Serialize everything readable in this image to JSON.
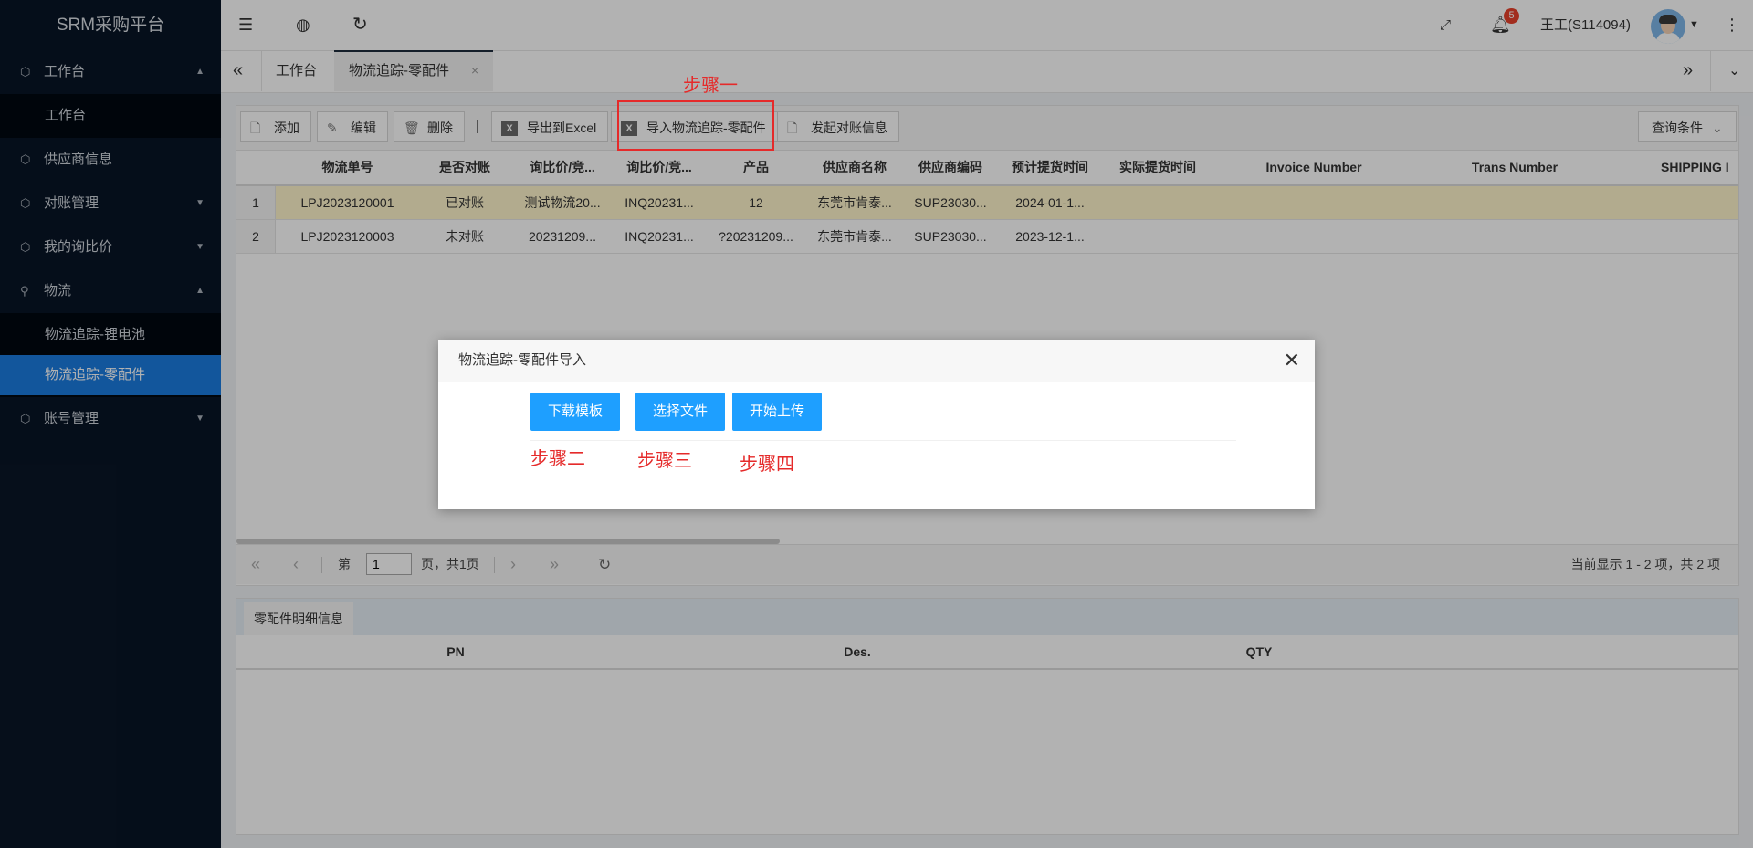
{
  "app": {
    "title": "SRM采购平台"
  },
  "sidebar": {
    "items": [
      {
        "label": "工作台",
        "expanded": true,
        "children": [
          "工作台"
        ]
      },
      {
        "label": "供应商信息"
      },
      {
        "label": "对账管理"
      },
      {
        "label": "我的询比价"
      },
      {
        "label": "物流",
        "expanded": true,
        "children": [
          "物流追踪-锂电池",
          "物流追踪-零配件"
        ],
        "active_child": "物流追踪-零配件"
      },
      {
        "label": "账号管理"
      }
    ]
  },
  "header": {
    "notification_count": "5",
    "user": "王工(S114094)"
  },
  "tabs": [
    {
      "label": "工作台"
    },
    {
      "label": "物流追踪-零配件",
      "active": true,
      "close": "×"
    }
  ],
  "toolbar": {
    "add": "添加",
    "edit": "编辑",
    "delete": "删除",
    "separator": "|",
    "export": "导出到Excel",
    "import": "导入物流追踪-零配件",
    "reconcile": "发起对账信息",
    "query": "查询条件"
  },
  "grid": {
    "columns": [
      "物流单号",
      "是否对账",
      "询比价/竞...",
      "询比价/竞...",
      "产品",
      "供应商名称",
      "供应商编码",
      "预计提货时间",
      "实际提货时间",
      "Invoice Number",
      "Trans Number",
      "SHIPPING I"
    ],
    "rows": [
      {
        "num": "1",
        "cells": [
          "LPJ2023120001",
          "已对账",
          "测试物流20...",
          "INQ20231...",
          "12",
          "东莞市肯泰...",
          "SUP23030...",
          "2024-01-1...",
          "",
          "",
          "",
          ""
        ]
      },
      {
        "num": "2",
        "cells": [
          "LPJ2023120003",
          "未对账",
          "20231209...",
          "INQ20231...",
          "?20231209...",
          "东莞市肯泰...",
          "SUP23030...",
          "2023-12-1...",
          "",
          "",
          "",
          ""
        ]
      }
    ]
  },
  "pager": {
    "page_label": "第",
    "page_value": "1",
    "total_label": "页，共1页",
    "summary": "当前显示 1 - 2 项，共 2 项"
  },
  "detail": {
    "tab": "零配件明细信息",
    "columns": [
      "PN",
      "Des.",
      "QTY"
    ]
  },
  "modal": {
    "title": "物流追踪-零配件导入",
    "close": "✕",
    "download": "下载模板",
    "choose": "选择文件",
    "upload": "开始上传"
  },
  "annotations": {
    "step1": "步骤一",
    "step2": "步骤二",
    "step3": "步骤三",
    "step4": "步骤四",
    "color": "#e52a2a"
  }
}
